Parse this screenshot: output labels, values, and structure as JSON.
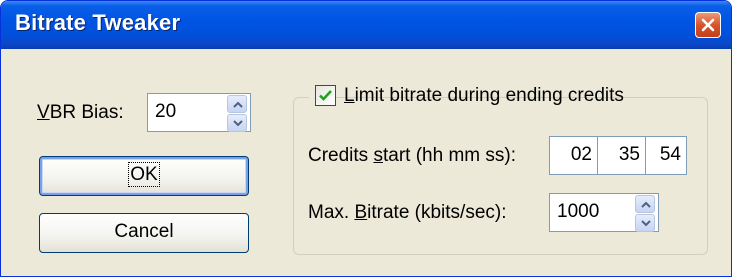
{
  "window": {
    "title": "Bitrate Tweaker"
  },
  "vbr": {
    "label_accel": "V",
    "label_rest": "BR Bias:",
    "value": "20"
  },
  "buttons": {
    "ok": "OK",
    "cancel": "Cancel"
  },
  "limit": {
    "checked": true,
    "label_accel": "L",
    "label_rest": "imit bitrate during ending credits"
  },
  "credits": {
    "label_pre": "Credits ",
    "label_accel": "s",
    "label_rest": "tart (hh mm ss):",
    "hh": "02",
    "mm": "35",
    "ss": "54"
  },
  "max_bitrate": {
    "label_pre": "Max. ",
    "label_accel": "B",
    "label_rest": "itrate (kbits/sec):",
    "value": "1000"
  }
}
